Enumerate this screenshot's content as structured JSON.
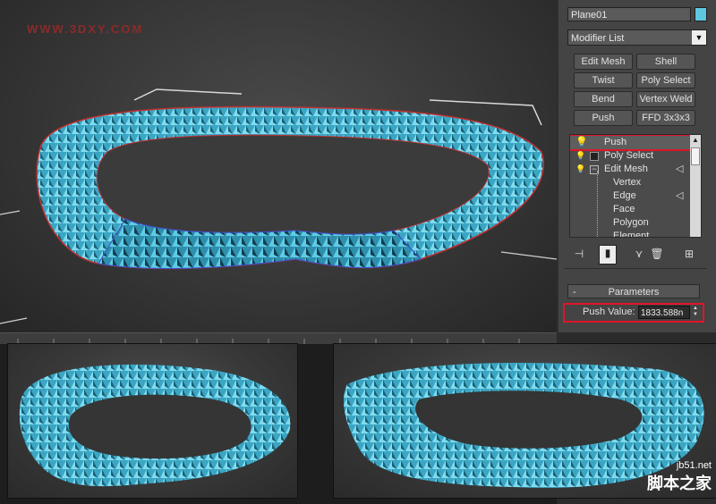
{
  "watermark_top": "WWW.3DXY.COM",
  "watermark_bottom": {
    "site": "jb51.net",
    "name": "脚本之家"
  },
  "panel": {
    "object_name": "Plane01",
    "object_color": "#5ec8e0",
    "modifier_list": "Modifier List",
    "buttons": [
      "Edit Mesh",
      "Shell",
      "Twist",
      "Poly Select",
      "Bend",
      "Vertex Weld",
      "Push",
      "FFD 3x3x3"
    ],
    "stack": [
      {
        "label": "Push",
        "selected": true
      },
      {
        "label": "Poly Select"
      },
      {
        "label": "Edit Mesh"
      }
    ],
    "sub_objects": [
      "Vertex",
      "Edge",
      "Face",
      "Polygon",
      "Element"
    ],
    "params_title": "Parameters",
    "push_label": "Push Value:",
    "push_value": "1833.588n"
  },
  "colors": {
    "mesh": "#4fb8d4",
    "highlight": "#e0142a",
    "panel": "#444444"
  }
}
